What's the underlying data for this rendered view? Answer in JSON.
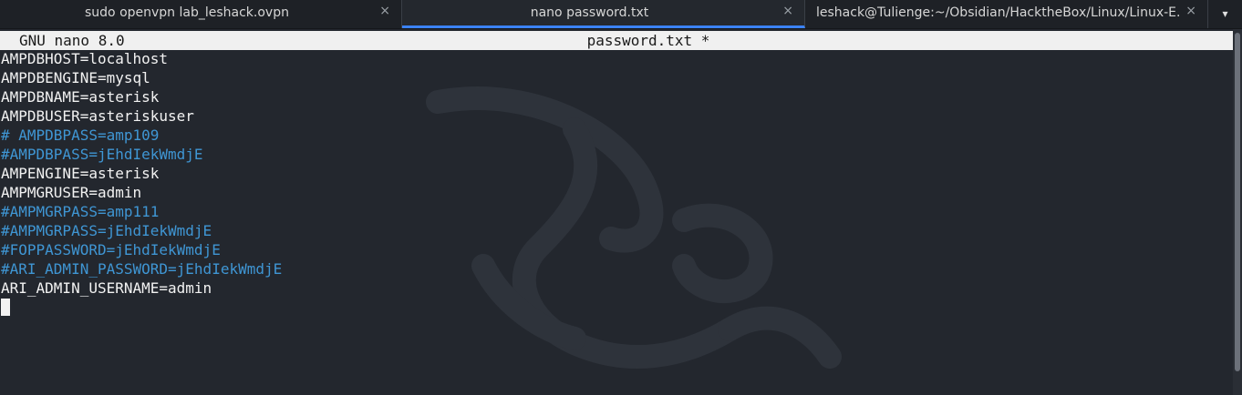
{
  "tabs": [
    {
      "label": "sudo openvpn lab_leshack.ovpn",
      "close": "×",
      "active": false
    },
    {
      "label": "nano password.txt",
      "close": "×",
      "active": true
    },
    {
      "label": "leshack@Tulienge:~/Obsidian/HacktheBox/Linux/Linux-E...",
      "close": "×",
      "active": false
    }
  ],
  "tab_menu_icon": "▾",
  "nano": {
    "version": "GNU nano 8.0",
    "filename": "password.txt *"
  },
  "file_lines": [
    {
      "text": "AMPDBHOST=localhost",
      "comment": false
    },
    {
      "text": "AMPDBENGINE=mysql",
      "comment": false
    },
    {
      "text": "AMPDBNAME=asterisk",
      "comment": false
    },
    {
      "text": "AMPDBUSER=asteriskuser",
      "comment": false
    },
    {
      "text": "# AMPDBPASS=amp109",
      "comment": true
    },
    {
      "text": "#AMPDBPASS=jEhdIekWmdjE",
      "comment": true
    },
    {
      "text": "AMPENGINE=asterisk",
      "comment": false
    },
    {
      "text": "AMPMGRUSER=admin",
      "comment": false
    },
    {
      "text": "#AMPMGRPASS=amp111",
      "comment": true
    },
    {
      "text": "#AMPMGRPASS=jEhdIekWmdjE",
      "comment": true
    },
    {
      "text": "#FOPPASSWORD=jEhdIekWmdjE",
      "comment": true
    },
    {
      "text": "#ARI_ADMIN_PASSWORD=jEhdIekWmdjE",
      "comment": true
    },
    {
      "text": "ARI_ADMIN_USERNAME=admin",
      "comment": false
    }
  ],
  "colors": {
    "background": "#23272e",
    "text": "#f2f2f2",
    "comment": "#3f96d4",
    "header_bg": "#f0f0f0",
    "active_tab_accent": "#3b82f6"
  }
}
